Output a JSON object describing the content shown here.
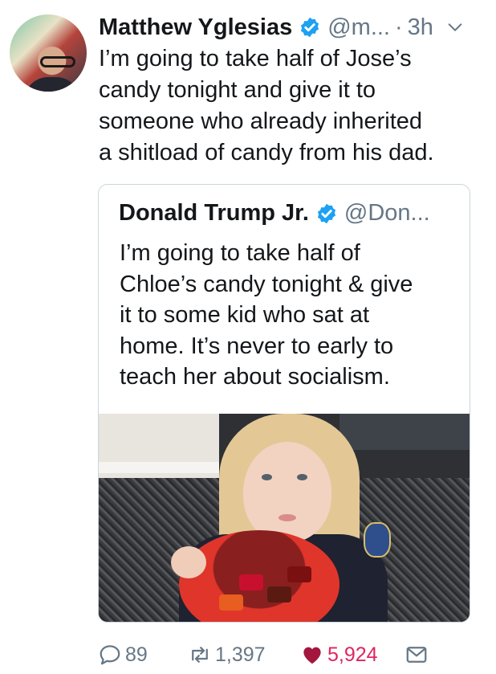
{
  "tweet": {
    "author_name": "Matthew Yglesias",
    "handle": "@m...",
    "separator": "·",
    "time": "3h",
    "text_lines": [
      "I’m going to take half of Jose’s",
      "candy tonight and give it to",
      "someone who already inherited",
      "a shitload of candy from his dad."
    ]
  },
  "quoted_tweet": {
    "author_name": "Donald Trump Jr.",
    "handle": "@Don...",
    "text_lines": [
      "I’m going to take half of",
      "Chloe’s candy tonight & give",
      "it to some kid who sat at",
      "home. It’s never to early to",
      "teach her about socialism."
    ]
  },
  "actions": {
    "replies": "89",
    "retweets": "1,397",
    "likes": "5,924"
  },
  "icons": {
    "avatar": "user-avatar",
    "verified": "verified-badge-icon",
    "menu": "chevron-down-icon",
    "reply": "reply-icon",
    "retweet": "retweet-icon",
    "like": "heart-icon",
    "message": "direct-message-icon"
  },
  "colors": {
    "verified": "#1da1f2",
    "secondary_text": "#657786",
    "like": "#e0245e",
    "border": "#ccd6dd"
  }
}
